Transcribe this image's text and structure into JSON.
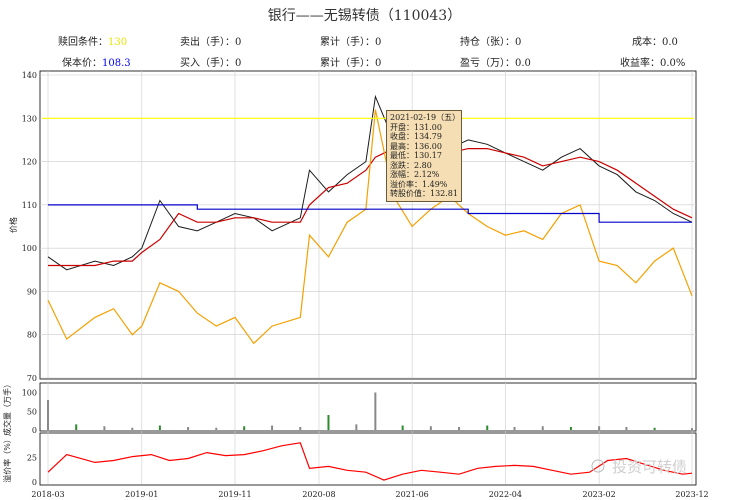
{
  "title": "银行——无锡转债（110043）",
  "info": {
    "row1": [
      {
        "label": "赎回条件：",
        "value": "130",
        "color": "#e6e600"
      },
      {
        "label": "卖出（手）：",
        "value": "0"
      },
      {
        "label": "累计（手）：",
        "value": "0"
      },
      {
        "label": "持仓（张）：",
        "value": "0"
      },
      {
        "label": "成本：",
        "value": "0.0"
      }
    ],
    "row2": [
      {
        "label": "保本价：",
        "value": "108.3",
        "color": "#0000ff"
      },
      {
        "label": "买入（手）：",
        "value": "0"
      },
      {
        "label": "累计（手）：",
        "value": "0"
      },
      {
        "label": "盈亏（万）：",
        "value": "0.0"
      },
      {
        "label": "收益率：",
        "value": "0.0%"
      }
    ]
  },
  "tooltip": {
    "lines": [
      "2021-02-19（五）",
      "开盘：131.00",
      "收盘：134.79",
      "最高：136.00",
      "最低：130.17",
      "涨跌：2.80",
      "涨幅：2.12%",
      "溢价率：1.49%",
      "转股价值：132.81"
    ]
  },
  "watermark": "投资可转债",
  "chart_data": [
    {
      "type": "line",
      "panel": "price",
      "ylabel": "价格",
      "ylim": [
        70,
        140
      ],
      "yticks": [
        70,
        80,
        90,
        100,
        110,
        120,
        130,
        140
      ],
      "x_tick_labels": [
        "2018-03",
        "2019-01",
        "2019-11",
        "2020-08",
        "2021-06",
        "2022-04",
        "2023-02",
        "2023-12"
      ],
      "x": [
        "2018-03",
        "2018-05",
        "2018-08",
        "2018-10",
        "2018-12",
        "2019-01",
        "2019-03",
        "2019-05",
        "2019-07",
        "2019-09",
        "2019-11",
        "2020-01",
        "2020-03",
        "2020-06",
        "2020-07",
        "2020-09",
        "2020-11",
        "2021-01",
        "2021-02",
        "2021-04",
        "2021-06",
        "2021-08",
        "2021-10",
        "2021-12",
        "2022-02",
        "2022-04",
        "2022-06",
        "2022-08",
        "2022-10",
        "2022-12",
        "2023-02",
        "2023-04",
        "2023-06",
        "2023-08",
        "2023-10",
        "2023-12"
      ],
      "series": [
        {
          "name": "",
          "color": "#1a1a1a",
          "values": [
            98,
            95,
            97,
            96,
            98,
            100,
            111,
            105,
            104,
            106,
            108,
            107,
            104,
            107,
            118,
            113,
            117,
            120,
            135,
            125,
            120,
            121,
            123,
            125,
            124,
            122,
            120,
            118,
            121,
            123,
            119,
            117,
            113,
            111,
            108,
            106
          ]
        },
        {
          "name": "",
          "color": "#cc0000",
          "values": [
            96,
            96,
            96,
            97,
            97,
            99,
            102,
            108,
            106,
            106,
            107,
            107,
            106,
            106,
            110,
            114,
            115,
            118,
            121,
            123,
            121,
            121,
            122,
            123,
            123,
            122,
            121,
            119,
            120,
            121,
            120,
            118,
            115,
            112,
            109,
            107
          ]
        },
        {
          "name": "",
          "color": "#f5a000",
          "values": [
            88,
            79,
            84,
            86,
            80,
            82,
            92,
            90,
            85,
            82,
            84,
            78,
            82,
            84,
            103,
            98,
            106,
            109,
            132,
            112,
            105,
            109,
            112,
            108,
            105,
            103,
            104,
            102,
            108,
            110,
            97,
            96,
            92,
            97,
            100,
            89
          ]
        },
        {
          "name": "",
          "color": "#0000cc",
          "step": true,
          "values": [
            110,
            110,
            110,
            110,
            110,
            110,
            110,
            110,
            109,
            109,
            109,
            109,
            109,
            109,
            109,
            109,
            109,
            109,
            109,
            109,
            109,
            109,
            109,
            108,
            108,
            108,
            108,
            108,
            108,
            108,
            106,
            106,
            106,
            106,
            106,
            106
          ]
        },
        {
          "name": "",
          "color": "#ffff00",
          "values": [
            130,
            130
          ]
        }
      ]
    },
    {
      "type": "bar",
      "panel": "volume",
      "ylabel": "成交量（万手）",
      "ylim": [
        0,
        120
      ],
      "yticks": [
        0,
        50,
        100
      ],
      "x": [
        "2018-03",
        "2018-06",
        "2018-09",
        "2018-12",
        "2019-03",
        "2019-06",
        "2019-09",
        "2019-12",
        "2020-03",
        "2020-06",
        "2020-09",
        "2020-12",
        "2021-02",
        "2021-05",
        "2021-08",
        "2021-11",
        "2022-02",
        "2022-05",
        "2022-08",
        "2022-11",
        "2023-02",
        "2023-05",
        "2023-08",
        "2023-12"
      ],
      "values": [
        80,
        15,
        10,
        6,
        12,
        8,
        6,
        10,
        12,
        8,
        40,
        15,
        100,
        12,
        10,
        8,
        12,
        8,
        10,
        8,
        10,
        8,
        6,
        5
      ]
    },
    {
      "type": "line",
      "panel": "premium",
      "ylabel": "溢价率（%）",
      "ylim": [
        -2,
        48
      ],
      "yticks": [
        0,
        25
      ],
      "x": [
        "2018-03",
        "2018-05",
        "2018-08",
        "2018-10",
        "2018-12",
        "2019-02",
        "2019-04",
        "2019-06",
        "2019-08",
        "2019-10",
        "2019-12",
        "2020-02",
        "2020-04",
        "2020-06",
        "2020-07",
        "2020-09",
        "2020-11",
        "2021-01",
        "2021-03",
        "2021-05",
        "2021-07",
        "2021-09",
        "2021-11",
        "2022-01",
        "2022-03",
        "2022-05",
        "2022-07",
        "2022-09",
        "2022-11",
        "2023-01",
        "2023-03",
        "2023-05",
        "2023-07",
        "2023-09",
        "2023-11",
        "2023-12"
      ],
      "series": [
        {
          "name": "",
          "color": "#ff0000",
          "values": [
            10,
            28,
            20,
            22,
            26,
            28,
            22,
            24,
            30,
            27,
            28,
            32,
            37,
            40,
            14,
            16,
            12,
            10,
            2,
            8,
            12,
            10,
            8,
            14,
            16,
            17,
            16,
            12,
            8,
            10,
            22,
            24,
            18,
            12,
            8,
            9
          ]
        }
      ]
    }
  ]
}
